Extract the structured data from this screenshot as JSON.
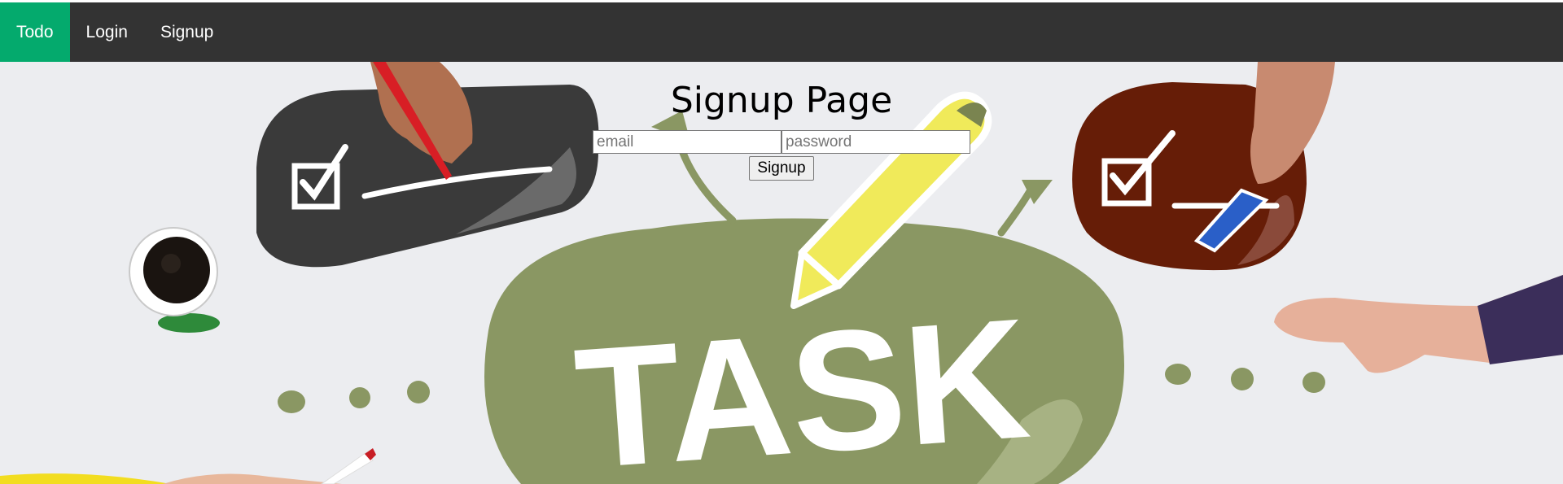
{
  "nav": {
    "items": [
      {
        "label": "Todo",
        "active": true
      },
      {
        "label": "Login",
        "active": false
      },
      {
        "label": "Signup",
        "active": false
      }
    ],
    "active_color": "#04aa6d",
    "bar_color": "#333333"
  },
  "page": {
    "title": "Signup Page"
  },
  "form": {
    "email_placeholder": "email",
    "password_placeholder": "password",
    "submit_label": "Signup"
  },
  "hero": {
    "word": "TASK",
    "blob_color": "#8a9763",
    "board_dark_color": "#3a3a3a",
    "board_red_color": "#661d07"
  }
}
